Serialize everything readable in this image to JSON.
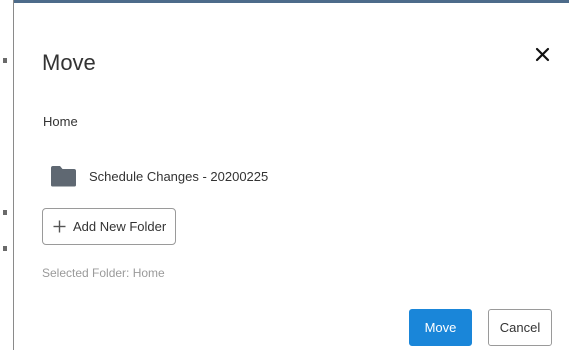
{
  "dialog": {
    "title": "Move",
    "close_icon": "close-icon",
    "breadcrumb": "Home",
    "folders": [
      {
        "name": "Schedule Changes - 20200225",
        "icon": "folder-icon"
      }
    ],
    "add_folder_label": "Add New Folder",
    "add_folder_icon": "plus-icon",
    "selected_folder_text": "Selected Folder: Home",
    "move_label": "Move",
    "cancel_label": "Cancel"
  },
  "colors": {
    "primary_button": "#1a86d9",
    "folder_icon": "#5f6872",
    "text": "#333333",
    "muted_text": "#9a9a9a"
  }
}
